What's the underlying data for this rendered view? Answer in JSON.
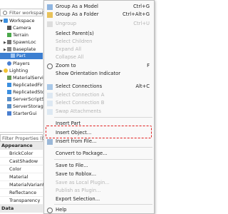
{
  "explorer": {
    "filter_placeholder": "Filter workspace",
    "items": [
      {
        "label": "Workspace",
        "icon": "workspace-icon"
      },
      {
        "label": "Camera",
        "icon": "camera-icon"
      },
      {
        "label": "Terrain",
        "icon": "terrain-icon"
      },
      {
        "label": "SpawnLoc",
        "icon": "spawn-location-icon"
      },
      {
        "label": "Baseplate",
        "icon": "part-icon"
      },
      {
        "label": "Part",
        "icon": "part-icon"
      },
      {
        "label": "Players",
        "icon": "players-icon"
      },
      {
        "label": "Lighting",
        "icon": "lighting-icon"
      },
      {
        "label": "MaterialServi",
        "icon": "material-service-icon"
      },
      {
        "label": "ReplicatedFir",
        "icon": "replicated-first-icon"
      },
      {
        "label": "ReplicatedSto",
        "icon": "replicated-storage-icon"
      },
      {
        "label": "ServerScriptS",
        "icon": "server-script-service-icon"
      },
      {
        "label": "ServerStorag",
        "icon": "server-storage-icon"
      },
      {
        "label": "StarterGui",
        "icon": "starter-gui-icon"
      }
    ]
  },
  "properties": {
    "filter_placeholder": "Filter Properties (Ctrl+",
    "sections": {
      "appearance": "Appearance",
      "data": "Data"
    },
    "rows": [
      "BrickColor",
      "CastShadow",
      "Color",
      "Material",
      "MaterialVariant",
      "Reflectance",
      "Transparency"
    ]
  },
  "menu": {
    "group_model": "Group As a Model",
    "group_model_sc": "Ctrl+G",
    "group_folder": "Group As a Folder",
    "group_folder_sc": "Ctrl+Alt+G",
    "ungroup": "Ungroup",
    "ungroup_sc": "Ctrl+U",
    "select_parents": "Select Parent(s)",
    "select_children": "Select Children",
    "expand_all": "Expand All",
    "collapse_all": "Collapse All",
    "zoom_to": "Zoom to",
    "zoom_to_sc": "F",
    "show_orientation": "Show Orientation Indicator",
    "select_connections": "Select Connections",
    "select_connections_sc": "Alt+C",
    "select_connection_a": "Select Connection A",
    "select_connection_b": "Select Connection B",
    "swap_attachments": "Swap Attachments",
    "insert_part": "Insert Part",
    "insert_object": "Insert Object...",
    "insert_from_file": "Insert from File...",
    "convert_package": "Convert to Package...",
    "save_file": "Save to File...",
    "save_roblox": "Save to Roblox...",
    "save_local_plugin": "Save as Local Plugin...",
    "publish_plugin": "Publish as Plugin...",
    "export_selection": "Export Selection...",
    "help": "Help"
  },
  "colors": {
    "selection": "#3d7fd1",
    "highlight": "#e02020"
  }
}
